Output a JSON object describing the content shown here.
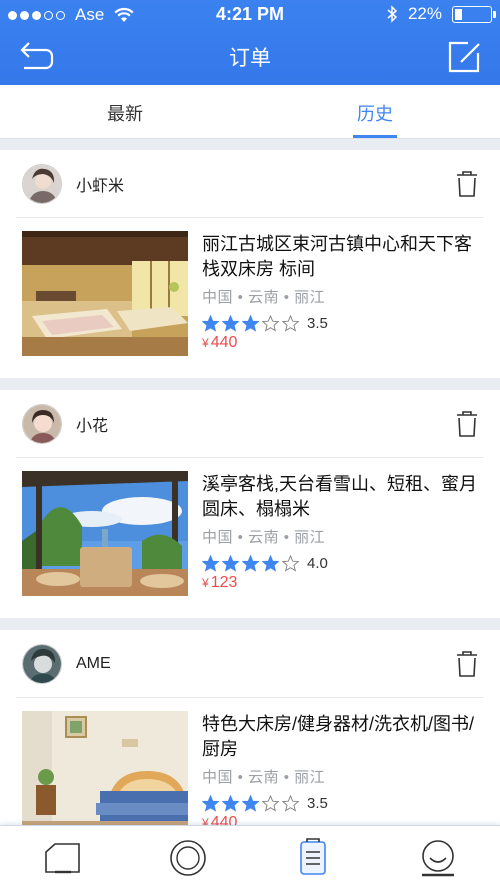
{
  "status": {
    "carrier": "Ase",
    "time": "4:21 PM",
    "battery": "22%",
    "battery_level": 0.22,
    "signal_dots": [
      true,
      true,
      true,
      false,
      false
    ]
  },
  "nav": {
    "title": "订单",
    "back_icon": "back-icon",
    "edit_icon": "edit-icon"
  },
  "tabs": [
    {
      "label": "最新",
      "active": false
    },
    {
      "label": "历史",
      "active": true
    }
  ],
  "orders": [
    {
      "user": "小虾米",
      "title": "丽江古城区束河古镇中心和天下客栈双床房 标间",
      "location": "中国 • 云南 • 丽江",
      "rating": 3,
      "score": "3.5",
      "currency": "¥",
      "price": "440"
    },
    {
      "user": "小花",
      "title": "溪亭客栈,天台看雪山、短租、蜜月圆床、榻榻米",
      "location": "中国 • 云南 • 丽江",
      "rating": 4,
      "score": "4.0",
      "currency": "¥",
      "price": "123"
    },
    {
      "user": "AME",
      "title": "特色大床房/健身器材/洗衣机/图书/厨房",
      "location": "中国 • 云南 • 丽江",
      "rating": 3,
      "score": "3.5",
      "currency": "¥",
      "price": "440"
    }
  ],
  "colors": {
    "accent": "#3f86f0",
    "price": "#ec4d4d",
    "star": "#3f86f0"
  },
  "tabbar": [
    "home-icon",
    "discover-icon",
    "orders-icon",
    "profile-icon"
  ]
}
